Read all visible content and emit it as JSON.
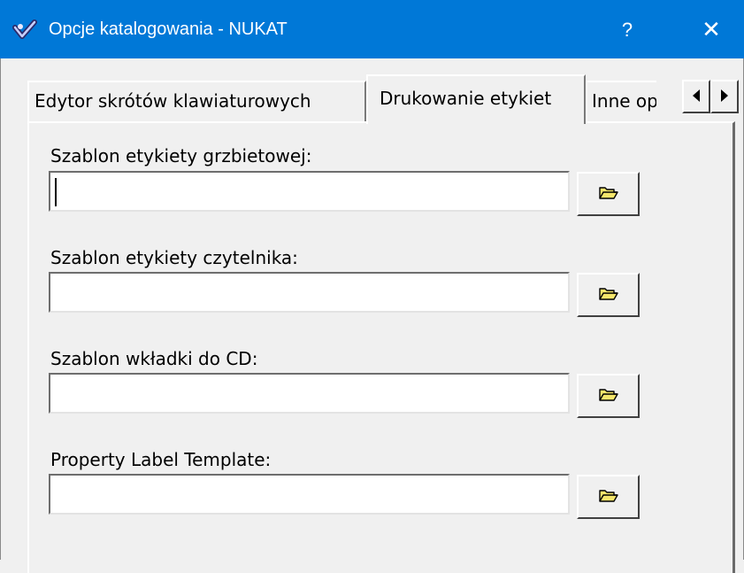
{
  "window": {
    "title": "Opcje katalogowania - NUKAT",
    "help_label": "?",
    "close_label": "✕",
    "icon": "checkmark-shield-icon"
  },
  "tabs": [
    {
      "label": "Edytor skrótów klawiaturowych",
      "active": false
    },
    {
      "label": "Drukowanie etykiet",
      "active": true
    },
    {
      "label": "Inne opcje",
      "active": false
    }
  ],
  "tab_scroll": {
    "left_icon": "arrow-left-icon",
    "right_icon": "arrow-right-icon"
  },
  "fields": [
    {
      "label": "Szablon etykiety grzbietowej:",
      "value": "",
      "browse_icon": "folder-open-icon"
    },
    {
      "label": "Szablon etykiety czytelnika:",
      "value": "",
      "browse_icon": "folder-open-icon"
    },
    {
      "label": "Szablon wkładki do CD:",
      "value": "",
      "browse_icon": "folder-open-icon"
    },
    {
      "label": "Property Label Template:",
      "value": "",
      "browse_icon": "folder-open-icon"
    }
  ],
  "colors": {
    "titlebar": "#0078d7",
    "window": "#f0f0f0",
    "folder_icon": "#f5e66b"
  }
}
